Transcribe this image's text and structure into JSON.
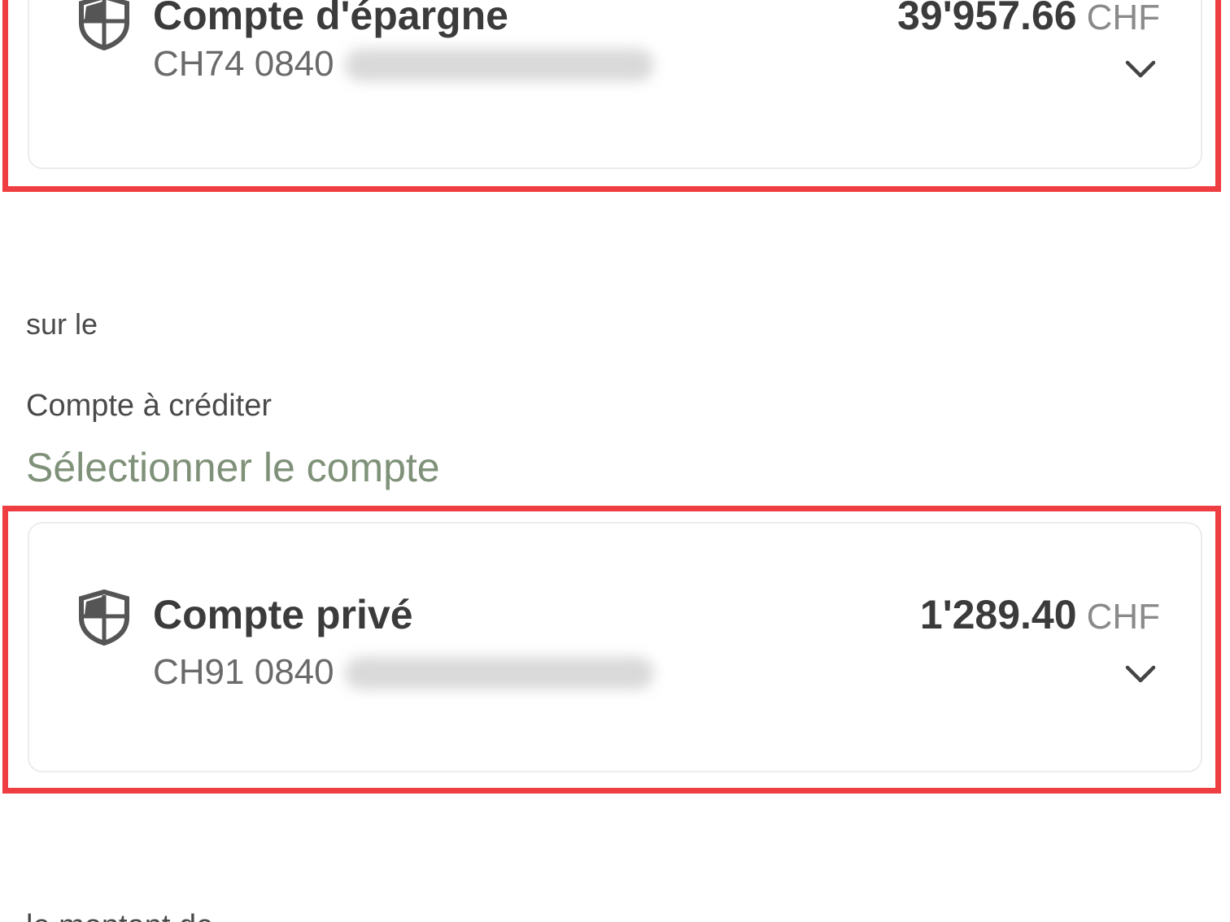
{
  "debit_account": {
    "name": "Compte d'épargne",
    "iban_prefix": "CH74 0840",
    "amount": "39'957.66",
    "currency": "CHF"
  },
  "labels": {
    "on_the": "sur le",
    "credit_account": "Compte à créditer",
    "select_account": "Sélectionner le compte",
    "amount_cut": "le montant de ..."
  },
  "credit_account": {
    "name": "Compte privé",
    "iban_prefix": "CH91 0840",
    "amount": "1'289.40",
    "currency": "CHF"
  },
  "colors": {
    "highlight": "#ef3e42",
    "placeholder": "#7f9178"
  },
  "icons": {
    "account": "shield-icon",
    "expand": "chevron-down-icon"
  }
}
